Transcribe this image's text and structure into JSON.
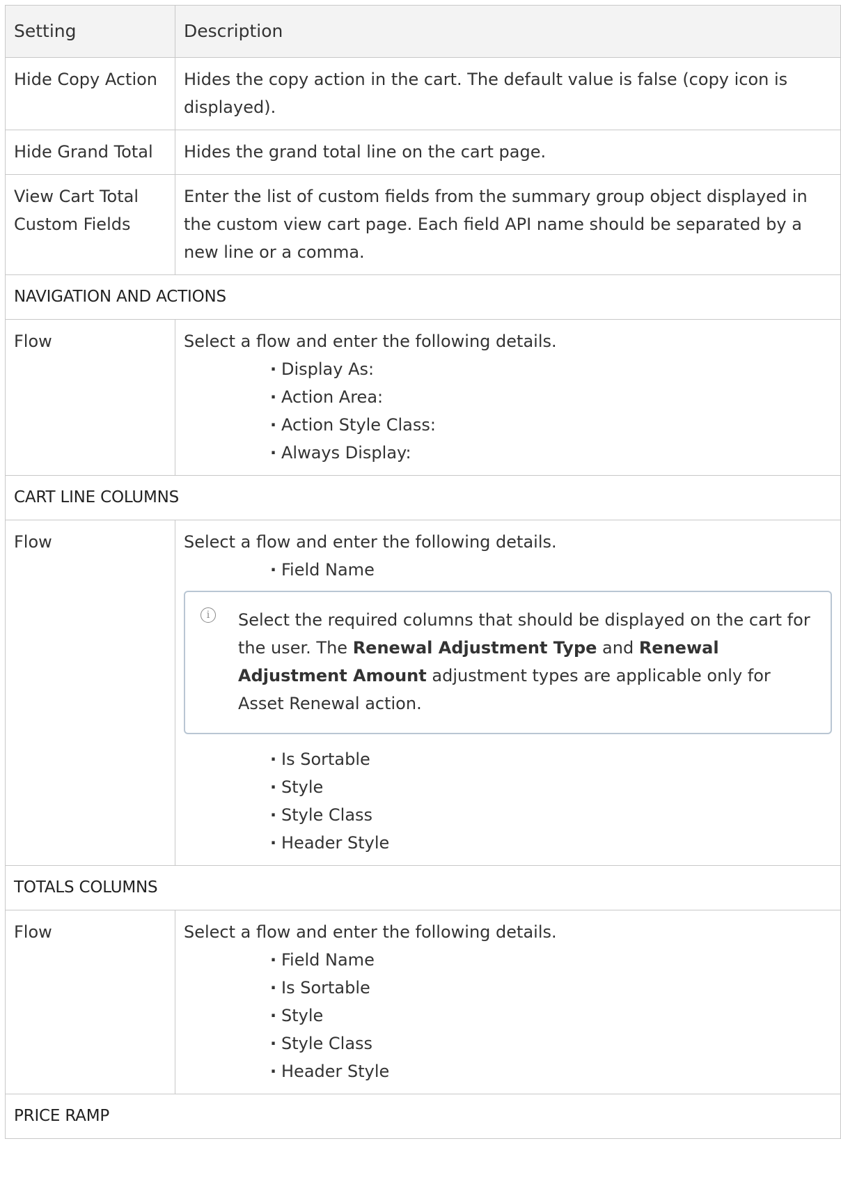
{
  "table": {
    "header": {
      "setting": "Setting",
      "description": "Description"
    },
    "rows": [
      {
        "setting": "Hide Copy Action",
        "description": "Hides the copy action in the cart. The default value is false (copy icon is displayed)."
      },
      {
        "setting": "Hide Grand Total",
        "description": "Hides the grand total line on the cart page."
      },
      {
        "setting": "View Cart Total Custom Fields",
        "description": "Enter the list of custom fields from the summary group object displayed in the custom view cart page. Each field API name should be separated by a new line or a comma."
      }
    ],
    "navigation_section": {
      "title": "NAVIGATION AND ACTIONS",
      "setting": "Flow",
      "description": "Select a flow and enter the following details.",
      "bullets": [
        "Display As:",
        "Action Area:",
        "Action Style Class:",
        "Always Display:"
      ]
    },
    "cart_line_section": {
      "title": "CART LINE COLUMNS",
      "setting": "Flow",
      "description": "Select a flow and enter the following details.",
      "bullets_before": [
        "Field Name"
      ],
      "note": {
        "icon": "info-icon",
        "text_1": "Select the required columns that should be displayed on the cart for the user. The ",
        "bold_1": "Renewal Adjustment Type",
        "text_2": " and ",
        "bold_2": "Renewal Adjustment Amount",
        "text_3": " adjustment types are applicable only for Asset Renewal action."
      },
      "bullets_after": [
        "Is Sortable",
        "Style",
        "Style Class",
        "Header Style"
      ]
    },
    "totals_section": {
      "title": "TOTALS COLUMNS",
      "setting": "Flow",
      "description": "Select a flow and enter the following details.",
      "bullets": [
        "Field Name",
        "Is Sortable",
        "Style",
        "Style Class",
        "Header Style"
      ]
    },
    "price_ramp_section": {
      "title": "PRICE RAMP"
    }
  }
}
